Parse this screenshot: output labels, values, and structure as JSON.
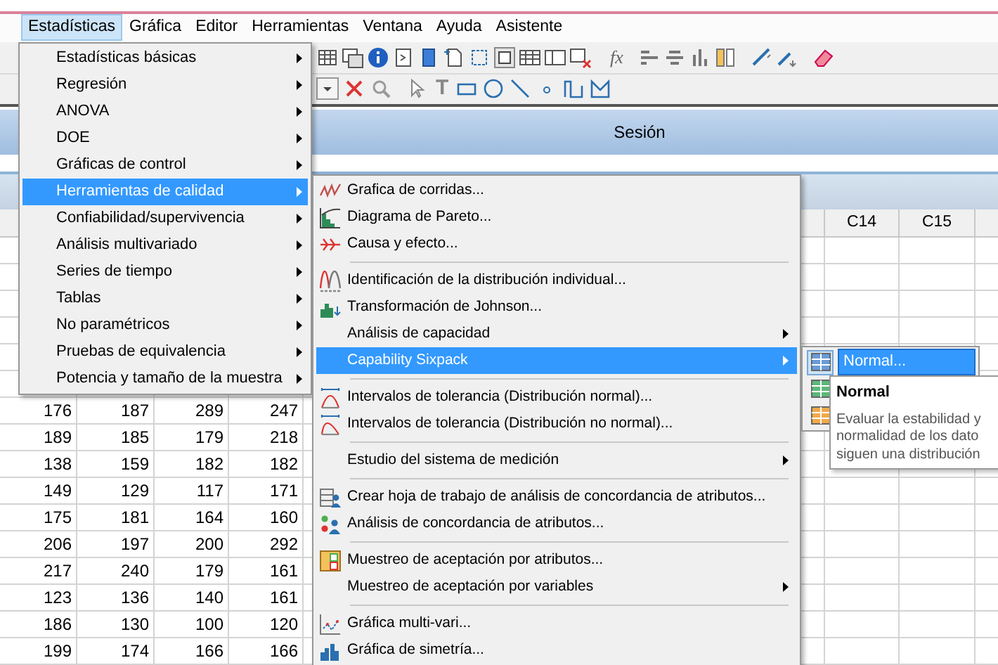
{
  "menubar": [
    {
      "label": "Estadísticas",
      "selected": true
    },
    {
      "label": "Gráfica",
      "selected": false
    },
    {
      "label": "Editor",
      "selected": false
    },
    {
      "label": "Herramientas",
      "selected": false
    },
    {
      "label": "Ventana",
      "selected": false
    },
    {
      "label": "Ayuda",
      "selected": false
    },
    {
      "label": "Asistente",
      "selected": false
    }
  ],
  "toolbar": {
    "formula_label": "fx",
    "text_tool_label": "T"
  },
  "session": {
    "title": "Sesión"
  },
  "worksheet": {
    "columns": [
      "C14",
      "C15"
    ],
    "rows": [
      [
        "176",
        "187",
        "289",
        "247"
      ],
      [
        "189",
        "185",
        "179",
        "218"
      ],
      [
        "138",
        "159",
        "182",
        "182"
      ],
      [
        "149",
        "129",
        "117",
        "171"
      ],
      [
        "175",
        "181",
        "164",
        "160"
      ],
      [
        "206",
        "197",
        "200",
        "292"
      ],
      [
        "217",
        "240",
        "179",
        "161"
      ],
      [
        "123",
        "136",
        "140",
        "161"
      ],
      [
        "186",
        "130",
        "100",
        "120"
      ],
      [
        "199",
        "174",
        "166",
        "166"
      ]
    ]
  },
  "stats_menu": {
    "items": [
      {
        "label": "Estadísticas básicas",
        "selected": false,
        "submenu": true
      },
      {
        "label": "Regresión",
        "selected": false,
        "submenu": true
      },
      {
        "label": "ANOVA",
        "selected": false,
        "submenu": true
      },
      {
        "label": "DOE",
        "selected": false,
        "submenu": true
      },
      {
        "label": "Gráficas de control",
        "selected": false,
        "submenu": true
      },
      {
        "label": "Herramientas de calidad",
        "selected": true,
        "submenu": true
      },
      {
        "label": "Confiabilidad/supervivencia",
        "selected": false,
        "submenu": true
      },
      {
        "label": "Análisis multivariado",
        "selected": false,
        "submenu": true
      },
      {
        "label": "Series de tiempo",
        "selected": false,
        "submenu": true
      },
      {
        "label": "Tablas",
        "selected": false,
        "submenu": true
      },
      {
        "label": "No paramétricos",
        "selected": false,
        "submenu": true
      },
      {
        "label": "Pruebas de equivalencia",
        "selected": false,
        "submenu": true
      },
      {
        "label": "Potencia y tamaño de la muestra",
        "selected": false,
        "submenu": true
      }
    ]
  },
  "quality_menu": {
    "items": [
      {
        "kind": "item",
        "label": "Grafica de corridas...",
        "selected": false,
        "submenu": false
      },
      {
        "kind": "item",
        "label": "Diagrama de Pareto...",
        "selected": false,
        "submenu": false
      },
      {
        "kind": "item",
        "label": "Causa y efecto...",
        "selected": false,
        "submenu": false
      },
      {
        "kind": "separator"
      },
      {
        "kind": "item",
        "label": "Identificación de la distribución individual...",
        "selected": false,
        "submenu": false
      },
      {
        "kind": "item",
        "label": "Transformación de Johnson...",
        "selected": false,
        "submenu": false
      },
      {
        "kind": "item",
        "label": "Análisis de capacidad",
        "selected": false,
        "submenu": true
      },
      {
        "kind": "item",
        "label": "Capability Sixpack",
        "selected": true,
        "submenu": true
      },
      {
        "kind": "separator"
      },
      {
        "kind": "item",
        "label": "Intervalos de tolerancia (Distribución normal)...",
        "selected": false,
        "submenu": false
      },
      {
        "kind": "item",
        "label": "Intervalos de tolerancia (Distribución no normal)...",
        "selected": false,
        "submenu": false
      },
      {
        "kind": "separator"
      },
      {
        "kind": "item",
        "label": "Estudio del sistema de medición",
        "selected": false,
        "submenu": true
      },
      {
        "kind": "separator"
      },
      {
        "kind": "item",
        "label": "Crear hoja de trabajo de análisis de concordancia de atributos...",
        "selected": false,
        "submenu": false
      },
      {
        "kind": "item",
        "label": "Análisis de concordancia de atributos...",
        "selected": false,
        "submenu": false
      },
      {
        "kind": "separator"
      },
      {
        "kind": "item",
        "label": "Muestreo de aceptación por atributos...",
        "selected": false,
        "submenu": false
      },
      {
        "kind": "item",
        "label": "Muestreo de aceptación por variables",
        "selected": false,
        "submenu": true
      },
      {
        "kind": "separator"
      },
      {
        "kind": "item",
        "label": "Gráfica multi-vari...",
        "selected": false,
        "submenu": false
      },
      {
        "kind": "item",
        "label": "Gráfica de simetría...",
        "selected": false,
        "submenu": false
      }
    ]
  },
  "sixpack_menu": {
    "items": [
      {
        "label": "Normal...",
        "selected": true
      },
      {
        "selected": false
      },
      {
        "selected": false
      }
    ]
  },
  "tooltip": {
    "title": "Normal",
    "lines": [
      "Evaluar la estabilidad y",
      "normalidad de los dato",
      "siguen una distribución"
    ]
  }
}
